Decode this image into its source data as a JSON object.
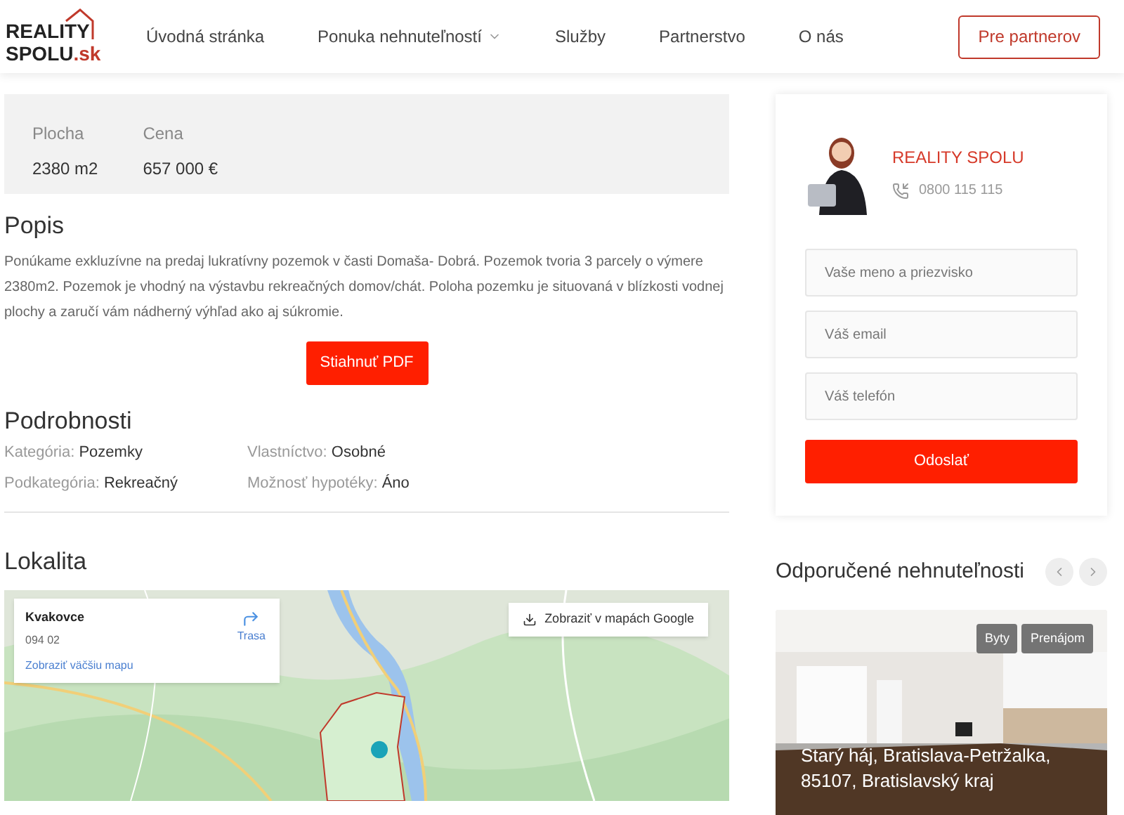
{
  "header": {
    "logo": {
      "line1": "REALITY",
      "line2": "SPOLU",
      "suffix": ".sk"
    },
    "nav": [
      {
        "label": "Úvodná stránka",
        "dropdown": false
      },
      {
        "label": "Ponuka nehnuteľností",
        "dropdown": true
      },
      {
        "label": "Služby",
        "dropdown": false
      },
      {
        "label": "Partnerstvo",
        "dropdown": false
      },
      {
        "label": "O nás",
        "dropdown": false
      }
    ],
    "partner_button": "Pre partnerov"
  },
  "stats": [
    {
      "label": "Plocha",
      "value": "2380 m2"
    },
    {
      "label": "Cena",
      "value": "657 000 €"
    }
  ],
  "description": {
    "heading": "Popis",
    "text": "Ponúkame exkluzívne na predaj lukratívny pozemok v časti Domaša- Dobrá. Pozemok tvoria 3 parcely o výmere 2380m2. Pozemok je vhodný na výstavbu rekreačných domov/chát. Poloha pozemku je situovaná v blízkosti vodnej plochy a zaručí vám nádherný výhľad ako aj súkromie.",
    "button": "Stiahnuť PDF"
  },
  "details": {
    "heading": "Podrobnosti",
    "items": [
      {
        "label": "Kategória:",
        "value": "Pozemky"
      },
      {
        "label": "Vlastníctvo:",
        "value": "Osobné"
      },
      {
        "label": "Podkategória:",
        "value": "Rekreačný"
      },
      {
        "label": "Možnosť hypotéky:",
        "value": "Áno"
      }
    ]
  },
  "location": {
    "heading": "Lokalita",
    "map": {
      "kind": "picture",
      "place_card": {
        "title": "Kvakovce",
        "subtitle": "094 02",
        "directions": "Trasa",
        "larger_map_link": "Zobraziť väčšiu mapu"
      },
      "open_button": "Zobraziť v mapách Google"
    }
  },
  "contact": {
    "company": "REALITY SPOLU",
    "phone": "0800 115 115",
    "fields": [
      {
        "placeholder": "Vaše meno a priezvisko"
      },
      {
        "placeholder": "Váš email"
      },
      {
        "placeholder": "Váš telefón"
      }
    ],
    "submit": "Odoslať"
  },
  "recommended": {
    "heading": "Odporučené nehnuteľnosti",
    "cards": [
      {
        "tags": [
          "Byty",
          "Prenájom"
        ],
        "title": "Starý háj, Bratislava-Petržalka, 85107, Bratislavský kraj"
      }
    ]
  }
}
